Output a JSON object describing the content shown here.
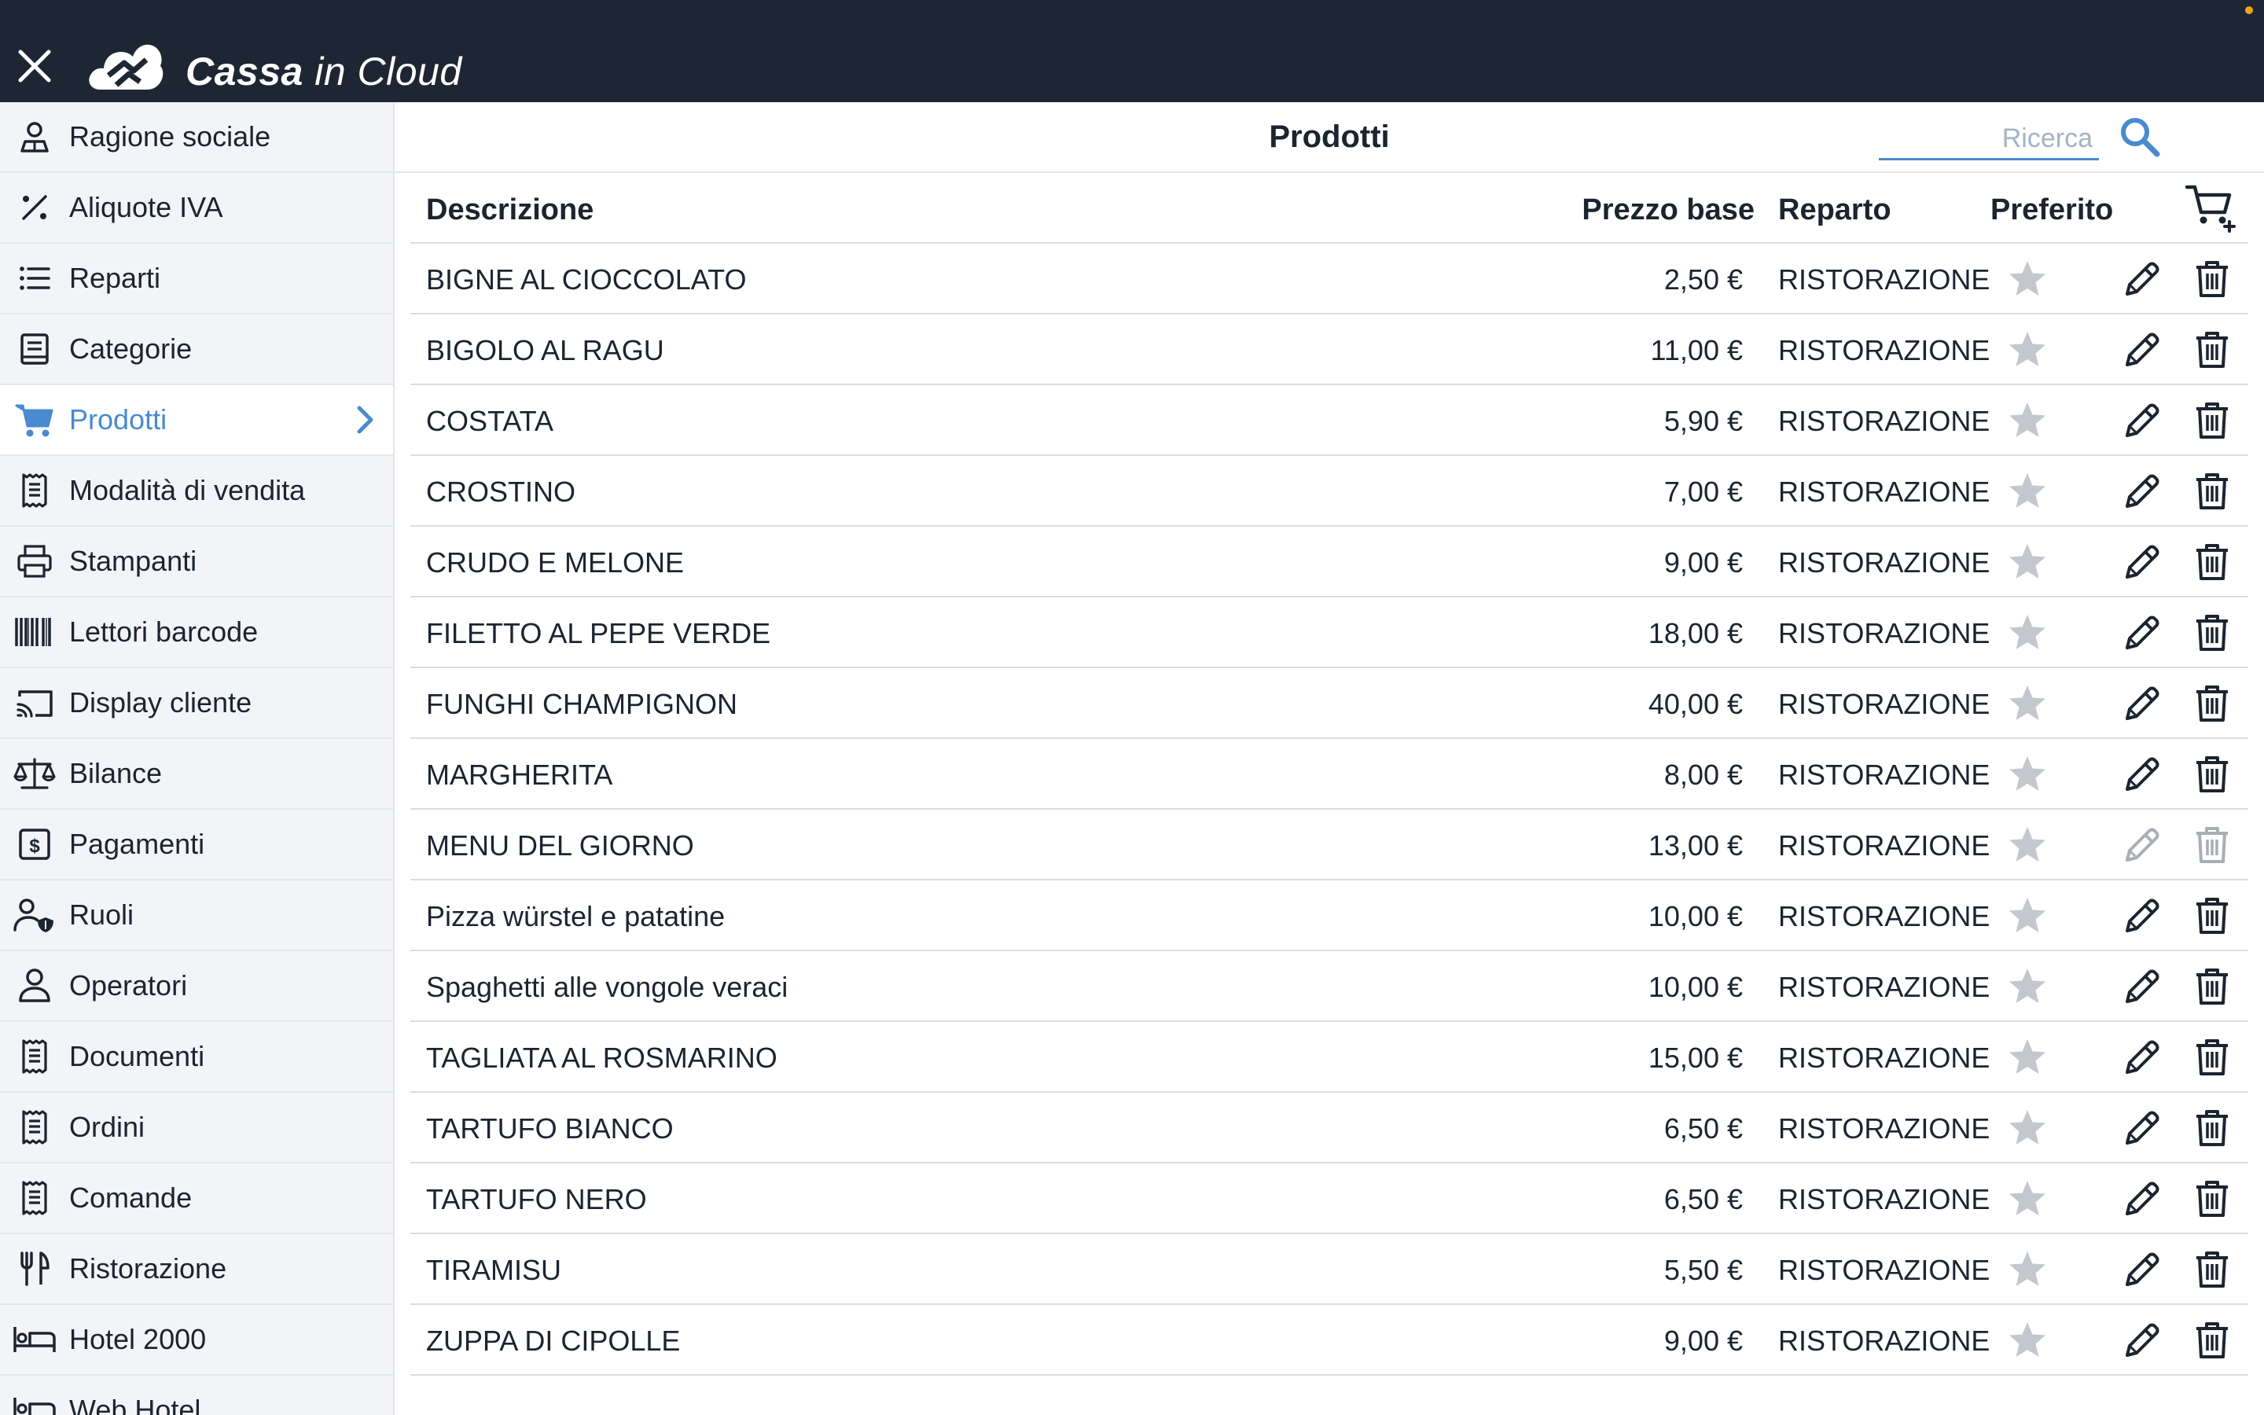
{
  "app": {
    "brand_bold": "Cassa",
    "brand_rest": " in Cloud"
  },
  "sidebar": {
    "items": [
      {
        "label": "Ragione sociale",
        "icon": "company-user-icon"
      },
      {
        "label": "Aliquote IVA",
        "icon": "percent-icon"
      },
      {
        "label": "Reparti",
        "icon": "list-icon"
      },
      {
        "label": "Categorie",
        "icon": "book-icon"
      },
      {
        "label": "Prodotti",
        "icon": "cart-icon",
        "active": true
      },
      {
        "label": "Modalità di vendita",
        "icon": "receipt-icon"
      },
      {
        "label": "Stampanti",
        "icon": "printer-icon"
      },
      {
        "label": "Lettori barcode",
        "icon": "barcode-icon"
      },
      {
        "label": "Display cliente",
        "icon": "cast-display-icon"
      },
      {
        "label": "Bilance",
        "icon": "scale-icon"
      },
      {
        "label": "Pagamenti",
        "icon": "dollar-icon"
      },
      {
        "label": "Ruoli",
        "icon": "user-shield-icon"
      },
      {
        "label": "Operatori",
        "icon": "user-icon"
      },
      {
        "label": "Documenti",
        "icon": "receipt-icon"
      },
      {
        "label": "Ordini",
        "icon": "receipt-icon"
      },
      {
        "label": "Comande",
        "icon": "receipt-icon"
      },
      {
        "label": "Ristorazione",
        "icon": "cutlery-icon"
      },
      {
        "label": "Hotel 2000",
        "icon": "bed-icon"
      },
      {
        "label": "Web Hotel",
        "icon": "bed-icon"
      }
    ]
  },
  "main": {
    "title": "Prodotti",
    "search_placeholder": "Ricerca",
    "columns": {
      "description": "Descrizione",
      "price": "Prezzo base",
      "department": "Reparto",
      "favorite": "Preferito"
    },
    "products": [
      {
        "description": "BIGNE AL CIOCCOLATO",
        "price": "2,50 €",
        "department": "RISTORAZIONE",
        "favorite": false,
        "editable": true
      },
      {
        "description": "BIGOLO AL RAGU",
        "price": "11,00 €",
        "department": "RISTORAZIONE",
        "favorite": false,
        "editable": true
      },
      {
        "description": "COSTATA",
        "price": "5,90 €",
        "department": "RISTORAZIONE",
        "favorite": false,
        "editable": true
      },
      {
        "description": "CROSTINO",
        "price": "7,00 €",
        "department": "RISTORAZIONE",
        "favorite": false,
        "editable": true
      },
      {
        "description": "CRUDO E MELONE",
        "price": "9,00 €",
        "department": "RISTORAZIONE",
        "favorite": false,
        "editable": true
      },
      {
        "description": "FILETTO AL PEPE VERDE",
        "price": "18,00 €",
        "department": "RISTORAZIONE",
        "favorite": false,
        "editable": true
      },
      {
        "description": "FUNGHI CHAMPIGNON",
        "price": "40,00 €",
        "department": "RISTORAZIONE",
        "favorite": false,
        "editable": true
      },
      {
        "description": "MARGHERITA",
        "price": "8,00 €",
        "department": "RISTORAZIONE",
        "favorite": false,
        "editable": true
      },
      {
        "description": "MENU DEL GIORNO",
        "price": "13,00 €",
        "department": "RISTORAZIONE",
        "favorite": false,
        "editable": false
      },
      {
        "description": "Pizza würstel e patatine",
        "price": "10,00 €",
        "department": "RISTORAZIONE",
        "favorite": false,
        "editable": true
      },
      {
        "description": "Spaghetti alle vongole veraci",
        "price": "10,00 €",
        "department": "RISTORAZIONE",
        "favorite": false,
        "editable": true
      },
      {
        "description": "TAGLIATA AL ROSMARINO",
        "price": "15,00 €",
        "department": "RISTORAZIONE",
        "favorite": false,
        "editable": true
      },
      {
        "description": "TARTUFO BIANCO",
        "price": "6,50 €",
        "department": "RISTORAZIONE",
        "favorite": false,
        "editable": true
      },
      {
        "description": "TARTUFO NERO",
        "price": "6,50 €",
        "department": "RISTORAZIONE",
        "favorite": false,
        "editable": true
      },
      {
        "description": "TIRAMISU",
        "price": "5,50 €",
        "department": "RISTORAZIONE",
        "favorite": false,
        "editable": true
      },
      {
        "description": "ZUPPA DI CIPOLLE",
        "price": "9,00 €",
        "department": "RISTORAZIONE",
        "favorite": false,
        "editable": true
      }
    ]
  },
  "colors": {
    "topbar": "#1e2633",
    "accent": "#4a8ad0",
    "sidebar_bg": "#f3f4f7",
    "star_gray": "#c4c7cc",
    "disabled_gray": "#a9adb4"
  }
}
